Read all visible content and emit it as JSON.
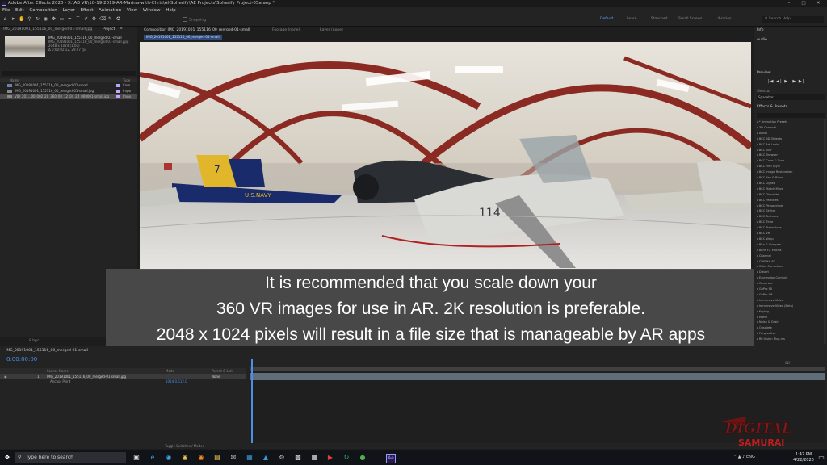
{
  "window": {
    "title": "Adobe After Effects 2020 - X:\\AB VR\\10-19-2019-AR-Marina-with-Chris\\AI-Spherify\\AE Projects\\Spherify Project-05a.aep *"
  },
  "menu": [
    "File",
    "Edit",
    "Composition",
    "Layer",
    "Effect",
    "Animation",
    "View",
    "Window",
    "Help"
  ],
  "toolbar": {
    "snapping_label": "Snapping",
    "workspaces": [
      "Default",
      "Learn",
      "Standard",
      "Small Screen",
      "Libraries"
    ],
    "search_placeholder": "Search Help",
    "tool_icons": [
      "home-icon",
      "selection-icon",
      "hand-icon",
      "zoom-icon",
      "rotate-icon",
      "camera-orbit-icon",
      "pan-behind-icon",
      "rectangle-icon",
      "pen-icon",
      "type-icon",
      "brush-icon",
      "clone-icon",
      "eraser-icon",
      "roto-icon",
      "puppet-icon"
    ]
  },
  "project_panel": {
    "tab": "Project",
    "tab_icon": "menu-icon",
    "footage_tab": "IMG_20191001_155116_00_merged-01-small.jpg",
    "thumbnail_name": "IMG_20191001_155116_00_merged-01-small",
    "meta_lines": [
      "IMG_20191001_155116_00_merged-01-small.ppg",
      "2048 x 1024 (1.00)",
      "Δ 0:00:02:12, 29.97 fps"
    ],
    "columns": {
      "name": "Name",
      "label": "",
      "type": "Type"
    },
    "rows": [
      {
        "name": "IMG_20191001_155116_00_merged-01-small",
        "type": "Com...",
        "label_color": "#a9a9ff"
      },
      {
        "name": "IMG_20191001_155116_00_merged-01-small.jpg",
        "type": "Impo",
        "label_color": "#c9a3ff"
      },
      {
        "name": "VID_201...00_002_20_360_00_12_04_24_000001-small.jpg",
        "type": "Impo",
        "label_color": "#c9a3ff"
      }
    ],
    "footer": "8 bpc"
  },
  "composition_viewer": {
    "tabs": [
      "Composition IMG_20191001_155116_00_merged-01-small",
      "Footage (none)",
      "Layer (none)"
    ],
    "sub_tab": "IMG_20191001_155116_00_merged-01-small"
  },
  "caption": {
    "lines": [
      "It is recommended that you scale down your",
      "360 VR images for use in AR. 2K resolution is preferable.",
      "2048 x 1024 pixels will result in a file size that is manageable by AR apps"
    ]
  },
  "right_panel": {
    "info_title": "Info",
    "audio_title": "Audio",
    "preview_title": "Preview",
    "preview_controls": "|◀ ◀| ▶ |▶ ▶|",
    "shortcut_label": "Shortcut",
    "shortcut_value": "Spacebar",
    "effects_title": "Effects & Presets",
    "effects": [
      "* Animation Presets",
      "3D Channel",
      "Audio",
      "BCC 3D Objects",
      "BCC Art Looks",
      "BCC Blur",
      "BCC Browser",
      "BCC Color & Tone",
      "BCC Film Style",
      "BCC Image Restoration",
      "BCC Key & Blend",
      "BCC Lights",
      "BCC Match Move",
      "BCC Obsolete",
      "BCC Particles",
      "BCC Perspective",
      "BCC Stylize",
      "BCC Textures",
      "BCC Time",
      "BCC Transitions",
      "BCC VR",
      "BCC Warp",
      "Blur & Sharpen",
      "Boris FX Mocha",
      "Channel",
      "CINEMA 4D",
      "Color Correction",
      "Distort",
      "Expression Controls",
      "Generate",
      "GoPro FX",
      "GoPro VR",
      "Immersive Video",
      "Immersive Video (Beta)",
      "Keying",
      "Matte",
      "Noise & Grain",
      "Obsolete",
      "Perspective",
      "RE:Vision Plug-ins"
    ]
  },
  "timeline": {
    "tab": "IMG_20191001_155116_00_merged-01-small",
    "timecode": "0:00:00:00",
    "columns": {
      "source": "Source Name",
      "mode": "Mode",
      "parent": "Parent & Link"
    },
    "layer": {
      "index": "1",
      "name": "IMG_20191001_155116_00_merged-01-small.jpg",
      "parent": "None"
    },
    "sub_item": "Anchor Point",
    "sub_value": "1024.0,512.0",
    "footer": "Toggle Switches / Modes",
    "ruler_end": "02f"
  },
  "logo": {
    "line1": "DIGITAL",
    "line2": "SAMURAI"
  },
  "taskbar": {
    "search_placeholder": "Type here to search",
    "time": "1:47 PM",
    "date": "4/22/2020",
    "language": "ENG",
    "apps": [
      "task-view-icon",
      "edge-icon",
      "chrome-icon",
      "edge-dev-icon",
      "firefox-icon",
      "file-explorer-icon",
      "mail-icon",
      "store-icon",
      "photos-icon",
      "steam-icon",
      "terminal-icon",
      "app-icon",
      "media-icon",
      "refresh-icon",
      "game-icon",
      "after-effects-icon"
    ]
  },
  "colors": {
    "accent_blue": "#4d8fe8",
    "caption_bg": "#4b4b4b",
    "ae_purple": "#9999ff"
  }
}
